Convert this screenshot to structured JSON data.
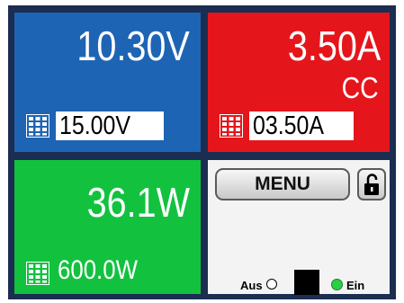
{
  "voltage": {
    "actual": "10.30V",
    "set": "15.00V"
  },
  "current": {
    "actual": "3.50A",
    "mode": "CC",
    "set": "03.50A"
  },
  "power": {
    "actual": "36.1W",
    "set": "600.0W"
  },
  "control": {
    "menu_label": "MENU",
    "off_label": "Aus",
    "on_label": "Ein"
  },
  "colors": {
    "voltage_panel": "#1e64b4",
    "current_panel": "#e4161c",
    "power_panel": "#12c23f",
    "frame": "#1b2d50",
    "on_indicator": "#28d048"
  },
  "icons": {
    "keypad": "keypad-icon",
    "lock": "lock-open-icon"
  }
}
